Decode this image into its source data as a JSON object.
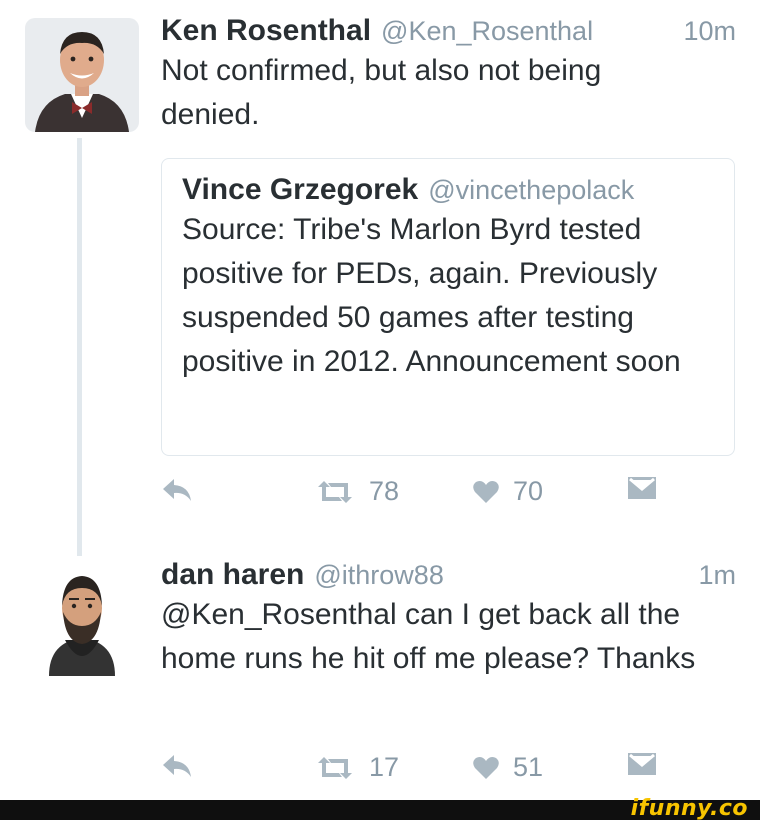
{
  "tweet1": {
    "name": "Ken Rosenthal",
    "handle": "@Ken_Rosenthal",
    "time": "10m",
    "text": "Not confirmed, but also not being denied."
  },
  "quote": {
    "name": "Vince Grzegorek",
    "handle": "@vincethepolack",
    "text": "Source: Tribe's Marlon Byrd tested positive for PEDs, again. Previously suspended 50 games after testing positive in 2012. Announcement soon"
  },
  "actions1": {
    "retweets": "78",
    "likes": "70"
  },
  "tweet2": {
    "name": "dan haren",
    "handle": "@ithrow88",
    "time": "1m",
    "text": "@Ken_Rosenthal can I get back all the home runs he hit off me please? Thanks"
  },
  "actions2": {
    "retweets": "17",
    "likes": "51"
  },
  "footer": {
    "brand": "ifunny.co"
  },
  "icons": {
    "reply": "reply-icon",
    "retweet": "retweet-icon",
    "like": "heart-icon",
    "dm": "envelope-icon"
  },
  "colors": {
    "icon": "#aab8c2",
    "muted": "#8899a6",
    "border": "#e1e8ed",
    "brand": "#f7c400"
  }
}
